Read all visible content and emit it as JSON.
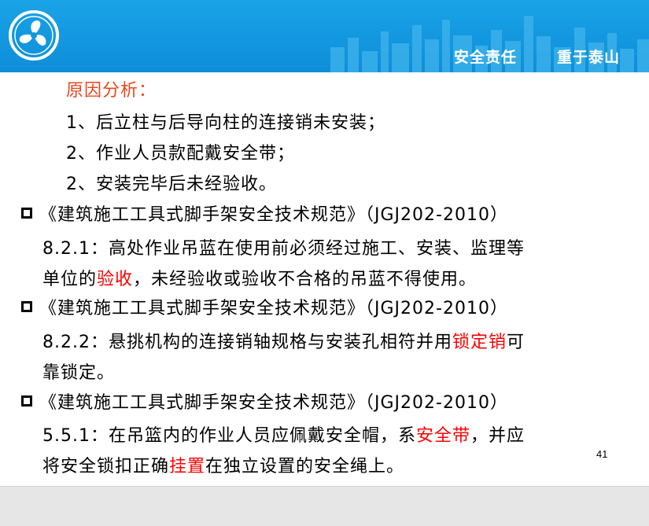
{
  "header": {
    "slogan_1": "安全责任",
    "slogan_2": "重于泰山",
    "logo_icon": "company-logo-icon",
    "bg_color": "#1296df"
  },
  "reasons": {
    "title": "原因分析：",
    "items": [
      "1、后立柱与后导向柱的连接销未安装；",
      "2、作业人员款配戴安全带；",
      "2、安装完毕后未经验收。"
    ]
  },
  "sections": [
    {
      "standard": "《建筑施工工具式脚手架安全技术规范》（JGJ202-2010）",
      "line1": "8.2.1：高处作业吊蓝在使用前必须经过施工、安装、监理等",
      "line2_pre": "单位的",
      "line2_red": "验收",
      "line2_post": "，未经验收或验收不合格的吊蓝不得使用。"
    },
    {
      "standard": "《建筑施工工具式脚手架安全技术规范》（JGJ202-2010）",
      "line1_pre": "8.2.2：悬挑机构的连接销轴规格与安装孔相符并用",
      "line1_red": "锁定销",
      "line1_post": "可",
      "line2": "靠锁定。"
    },
    {
      "standard": "《建筑施工工具式脚手架安全技术规范》（JGJ202-2010）",
      "line1_pre": "5.5.1：在吊篮内的作业人员应佩戴安全帽，系",
      "line1_red": "安全带",
      "line1_post": "，并应",
      "line2_pre": "将安全锁扣正确",
      "line2_red": "挂置",
      "line2_post": "在独立设置的安全绳上。"
    }
  ],
  "page_number": "41",
  "colors": {
    "highlight": "#ff0000",
    "title": "#e8461e"
  }
}
